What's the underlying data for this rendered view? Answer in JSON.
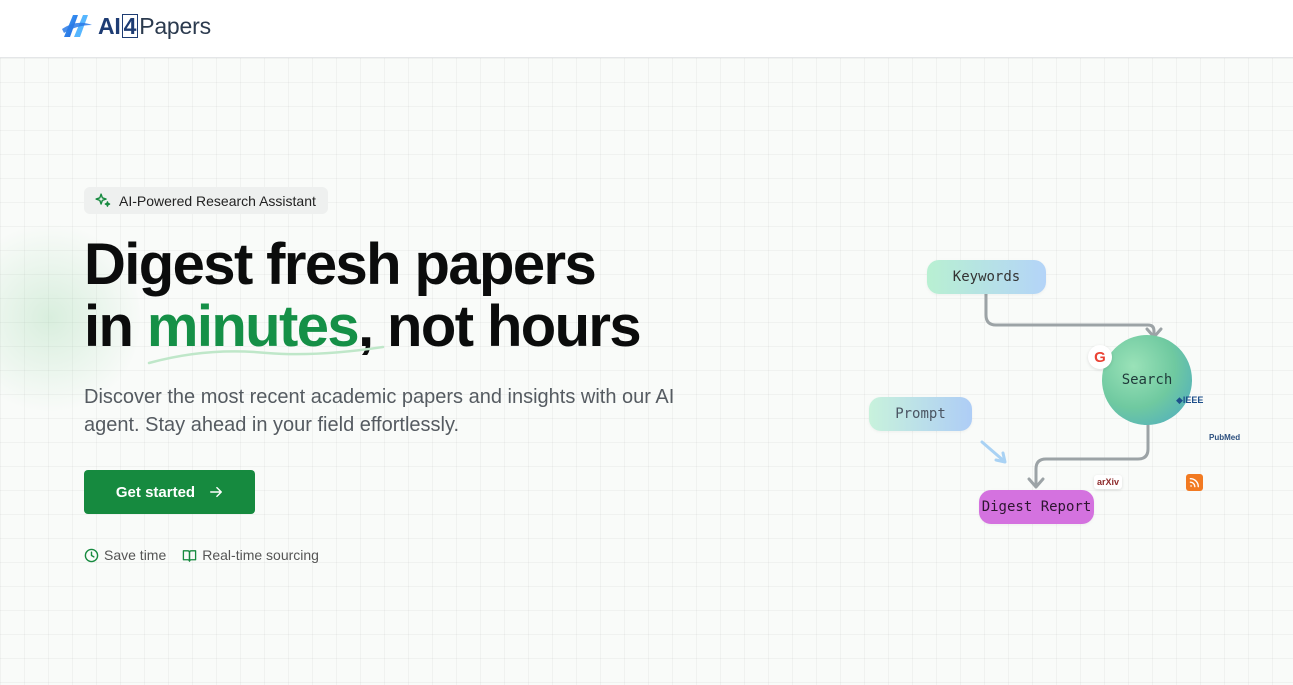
{
  "brand": {
    "name_prefix": "AI",
    "name_number": "4",
    "name_suffix": "Papers"
  },
  "hero": {
    "badge": "AI-Powered Research Assistant",
    "headline_line1": "Digest fresh papers",
    "headline_line2_pre": "in ",
    "headline_highlight": "minutes",
    "headline_line2_post": ", not hours",
    "subtext": "Discover the most recent academic papers and insights with our AI agent. Stay ahead in your field effortlessly.",
    "cta_label": "Get started",
    "features": [
      {
        "icon": "clock-icon",
        "label": "Save time"
      },
      {
        "icon": "book-open-icon",
        "label": "Real-time sourcing"
      }
    ]
  },
  "diagram": {
    "keywords": "Keywords",
    "prompt": "Prompt",
    "search": "Search",
    "digest": "Digest Report",
    "sources": {
      "google": "G",
      "ieee": "◆IEEE",
      "pubmed": "PubMed",
      "arxiv": "arXiv",
      "rss": "RSS"
    }
  },
  "colors": {
    "accent_green": "#168a3f",
    "highlight_green": "#159047",
    "digest_pill": "#d472df"
  }
}
